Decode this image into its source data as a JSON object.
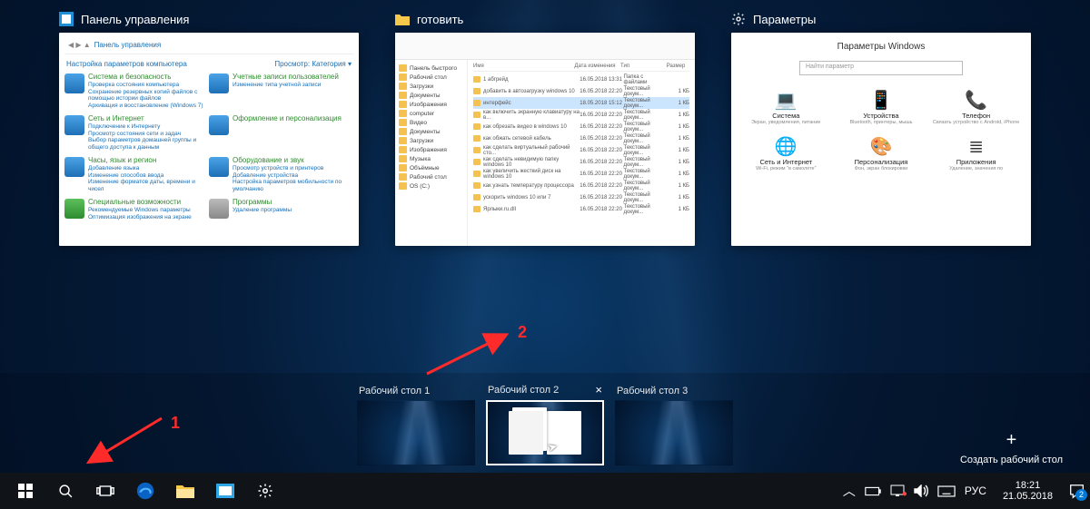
{
  "windows": [
    {
      "title": "Панель управления",
      "icon": "control-panel"
    },
    {
      "title": "готовить",
      "icon": "folder"
    },
    {
      "title": "Параметры",
      "icon": "settings"
    }
  ],
  "control_panel": {
    "breadcrumb": "Панель управления",
    "subtitle": "Настройка параметров компьютера",
    "view_label": "Просмотр:",
    "view_value": "Категория",
    "items": [
      {
        "title": "Система и безопасность",
        "subs": [
          "Проверка состояния компьютера",
          "Сохранение резервных копий файлов с помощью истории файлов",
          "Архивация и восстановление (Windows 7)"
        ]
      },
      {
        "title": "Учетные записи пользователей",
        "subs": [
          "Изменение типа учетной записи"
        ]
      },
      {
        "title": "Сеть и Интернет",
        "subs": [
          "Подключение к Интернету",
          "Просмотр состояния сети и задач",
          "Выбор параметров домашней группы и общего доступа к данным"
        ]
      },
      {
        "title": "Оформление и персонализация",
        "subs": []
      },
      {
        "title": "Часы, язык и регион",
        "subs": [
          "Добавление языка",
          "Изменение способов ввода",
          "Изменение форматов даты, времени и чисел"
        ]
      },
      {
        "title": "Оборудование и звук",
        "subs": [
          "Просмотр устройств и принтеров",
          "Добавление устройства",
          "Настройка параметров мобильности по умолчанию"
        ]
      },
      {
        "title": "Специальные возможности",
        "subs": [
          "Рекомендуемые Windows параметры",
          "Оптимизация изображения на экране"
        ]
      },
      {
        "title": "Программы",
        "subs": [
          "Удаление программы"
        ]
      }
    ]
  },
  "explorer": {
    "sidebar": [
      "Панель быстрого",
      "Рабочий стол",
      "Загрузки",
      "Документы",
      "Изображения",
      "computer",
      "Видео",
      "Документы",
      "Загрузки",
      "Изображения",
      "Музыка",
      "Объёмные",
      "Рабочий стол",
      "OS (C:)"
    ],
    "columns": [
      "Имя",
      "Дата изменения",
      "Тип",
      "Размер"
    ],
    "rows": [
      {
        "name": "1 абгрейд",
        "date": "16.05.2018 13:31",
        "type": "Папка с файлами",
        "size": ""
      },
      {
        "name": "добавить в автозагрузку windows 10",
        "date": "16.05.2018 22:20",
        "type": "Текстовый докум...",
        "size": "1 КБ"
      },
      {
        "name": "интерфейс",
        "date": "18.05.2018 15:12",
        "type": "Текстовый докум...",
        "size": "1 КБ",
        "sel": true
      },
      {
        "name": "как включить экранную клавиатуру на в...",
        "date": "16.05.2018 22:20",
        "type": "Текстовый докум...",
        "size": "1 КБ"
      },
      {
        "name": "как обрезать видео в windows 10",
        "date": "16.05.2018 22:20",
        "type": "Текстовый докум...",
        "size": "1 КБ"
      },
      {
        "name": "как обжать сетевой кабель",
        "date": "16.05.2018 22:20",
        "type": "Текстовый докум...",
        "size": "1 КБ"
      },
      {
        "name": "как сделать виртуальный рабочий сто...",
        "date": "16.05.2018 22:20",
        "type": "Текстовый докум...",
        "size": "1 КБ"
      },
      {
        "name": "как сделать невидимую папку windows 10",
        "date": "16.05.2018 22:20",
        "type": "Текстовый докум...",
        "size": "1 КБ"
      },
      {
        "name": "как увеличить жесткий диск на windows 10",
        "date": "16.05.2018 22:20",
        "type": "Текстовый докум...",
        "size": "1 КБ"
      },
      {
        "name": "как узнать температуру процессора",
        "date": "16.05.2018 22:20",
        "type": "Текстовый докум...",
        "size": "1 КБ"
      },
      {
        "name": "ускорить windows 10 или 7",
        "date": "16.05.2018 22:20",
        "type": "Текстовый докум...",
        "size": "1 КБ"
      },
      {
        "name": "Ярлыки.ru.dll",
        "date": "16.05.2018 22:20",
        "type": "Текстовый докум...",
        "size": "1 КБ"
      }
    ]
  },
  "settings": {
    "title": "Параметры Windows",
    "search_placeholder": "Найти параметр",
    "cells": [
      {
        "icon": "💻",
        "label": "Система",
        "sub": "Экран, уведомления, питание"
      },
      {
        "icon": "📱",
        "label": "Устройства",
        "sub": "Bluetooth, принтеры, мышь"
      },
      {
        "icon": "📞",
        "label": "Телефон",
        "sub": "Связать устройство с Android, iPhone"
      },
      {
        "icon": "🌐",
        "label": "Сеть и Интернет",
        "sub": "Wi-Fi, режим \"в самолете\""
      },
      {
        "icon": "🎨",
        "label": "Персонализация",
        "sub": "Фон, экран блокировки"
      },
      {
        "icon": "≣",
        "label": "Приложения",
        "sub": "Удаление, значения по"
      }
    ]
  },
  "desktops": [
    {
      "label": "Рабочий стол 1",
      "active": false,
      "close": false,
      "has_windows": false
    },
    {
      "label": "Рабочий стол 2",
      "active": true,
      "close": true,
      "has_windows": true
    },
    {
      "label": "Рабочий стол 3",
      "active": false,
      "close": false,
      "has_windows": false
    }
  ],
  "new_desktop_label": "Создать рабочий стол",
  "annotations": {
    "one": "1",
    "two": "2"
  },
  "tray": {
    "lang": "РУС",
    "time": "18:21",
    "date": "21.05.2018",
    "notifications": "2"
  }
}
